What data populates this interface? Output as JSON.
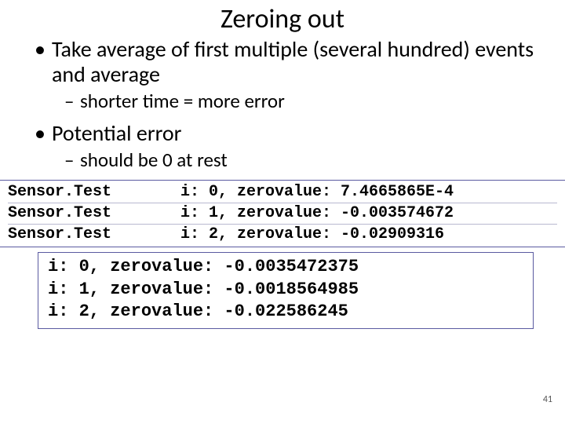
{
  "title": "Zeroing out",
  "bullets": {
    "b1": "Take average of first multiple (several hundred) events and average",
    "b1a": "shorter time = more error",
    "b2": "Potential error",
    "b2a": "should be 0 at rest"
  },
  "log1": {
    "rows": [
      {
        "tag": "Sensor.Test",
        "rest": "i: 0, zerovalue: 7.4665865E-4"
      },
      {
        "tag": "Sensor.Test",
        "rest": "i: 1, zerovalue: -0.003574672"
      },
      {
        "tag": "Sensor.Test",
        "rest": "i: 2, zerovalue: -0.02909316"
      }
    ]
  },
  "log2": {
    "lines": [
      "i: 0, zerovalue: -0.0035472375",
      "i: 1, zerovalue: -0.0018564985",
      "i: 2, zerovalue: -0.022586245"
    ]
  },
  "page_number": "41"
}
